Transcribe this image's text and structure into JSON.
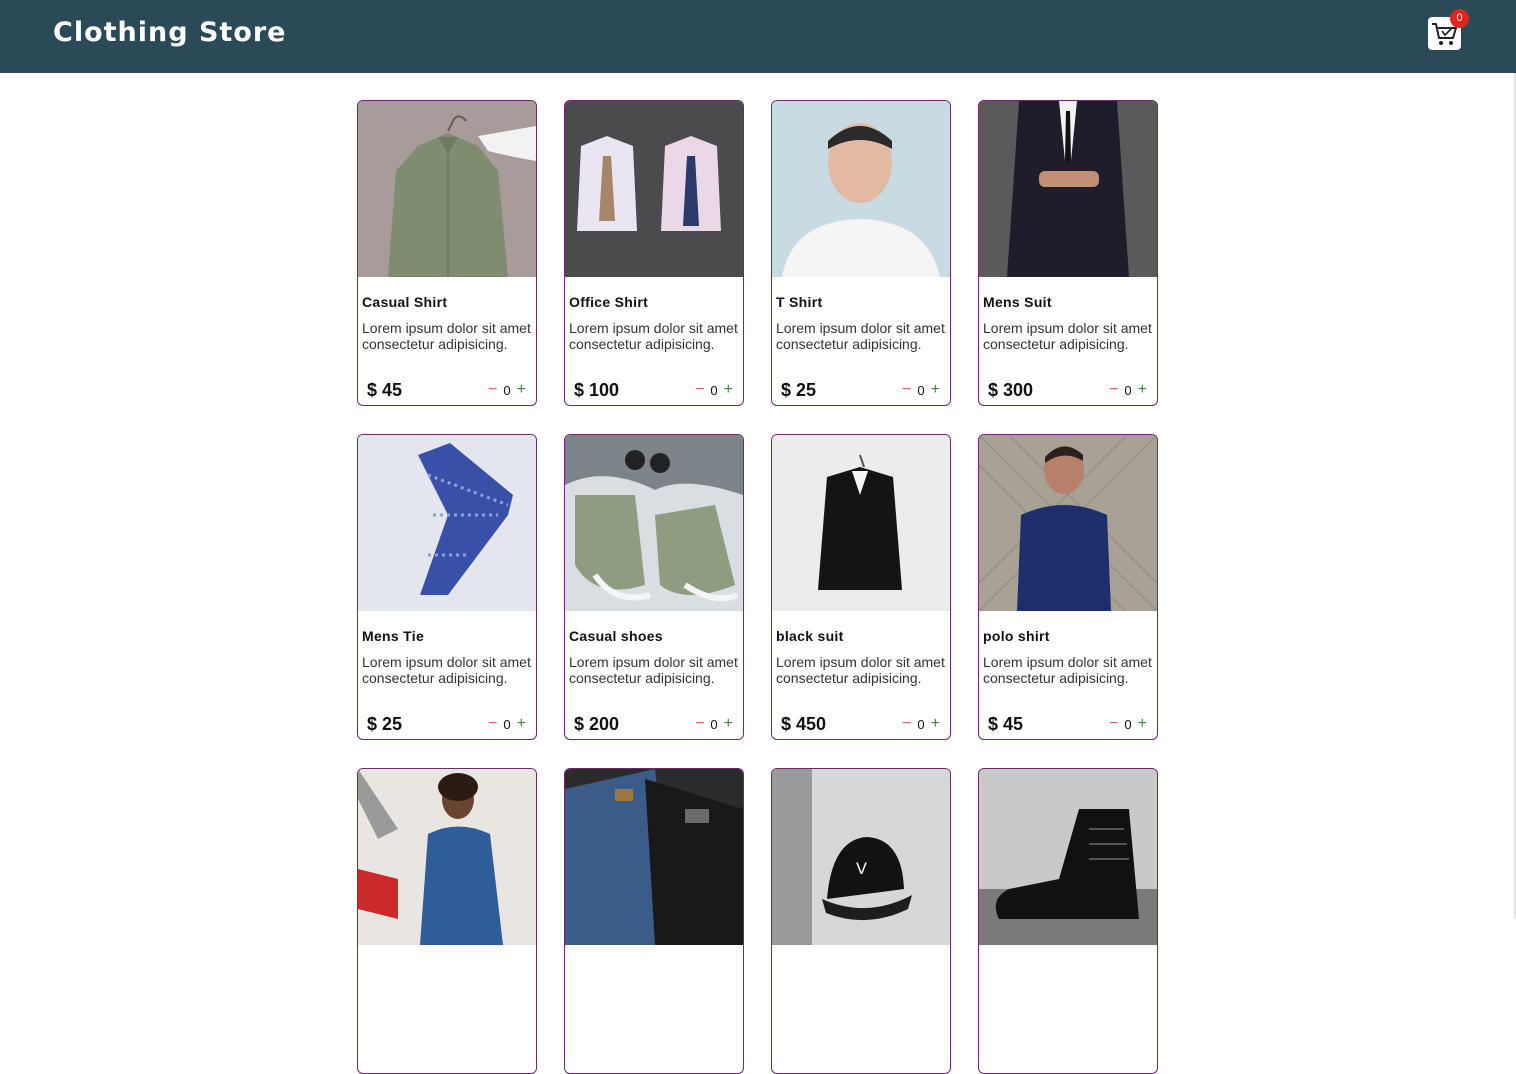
{
  "header": {
    "title": "Clothing Store",
    "cart_count": "0"
  },
  "qty_symbols": {
    "minus": "−",
    "plus": "+"
  },
  "products": [
    {
      "name": "Casual Shirt",
      "desc": "Lorem ipsum dolor sit amet consectetur adipisicing.",
      "price": "$ 45",
      "qty": "0",
      "image": "green shirt on hanger"
    },
    {
      "name": "Office Shirt",
      "desc": "Lorem ipsum dolor sit amet consectetur adipisicing.",
      "price": "$ 100",
      "qty": "0",
      "image": "two folded shirts with ties"
    },
    {
      "name": "T Shirt",
      "desc": "Lorem ipsum dolor sit amet consectetur adipisicing.",
      "price": "$ 25",
      "qty": "0",
      "image": "man in white t-shirt"
    },
    {
      "name": "Mens Suit",
      "desc": "Lorem ipsum dolor sit amet consectetur adipisicing.",
      "price": "$ 300",
      "qty": "0",
      "image": "man in dark suit"
    },
    {
      "name": "Mens Tie",
      "desc": "Lorem ipsum dolor sit amet consectetur adipisicing.",
      "price": "$ 25",
      "qty": "0",
      "image": "blue patterned tie"
    },
    {
      "name": "Casual shoes",
      "desc": "Lorem ipsum dolor sit amet consectetur adipisicing.",
      "price": "$ 200",
      "qty": "0",
      "image": "green sneakers"
    },
    {
      "name": "black suit",
      "desc": "Lorem ipsum dolor sit amet consectetur adipisicing.",
      "price": "$ 450",
      "qty": "0",
      "image": "black suit jacket on hanger"
    },
    {
      "name": "polo shirt",
      "desc": "Lorem ipsum dolor sit amet consectetur adipisicing.",
      "price": "$ 45",
      "qty": "0",
      "image": "man in navy polo shirt"
    },
    {
      "name": "",
      "desc": "",
      "price": "",
      "qty": "",
      "image": "man in denim jacket"
    },
    {
      "name": "",
      "desc": "",
      "price": "",
      "qty": "",
      "image": "jeans"
    },
    {
      "name": "",
      "desc": "",
      "price": "",
      "qty": "",
      "image": "black cap"
    },
    {
      "name": "",
      "desc": "",
      "price": "",
      "qty": "",
      "image": "black boot"
    }
  ]
}
